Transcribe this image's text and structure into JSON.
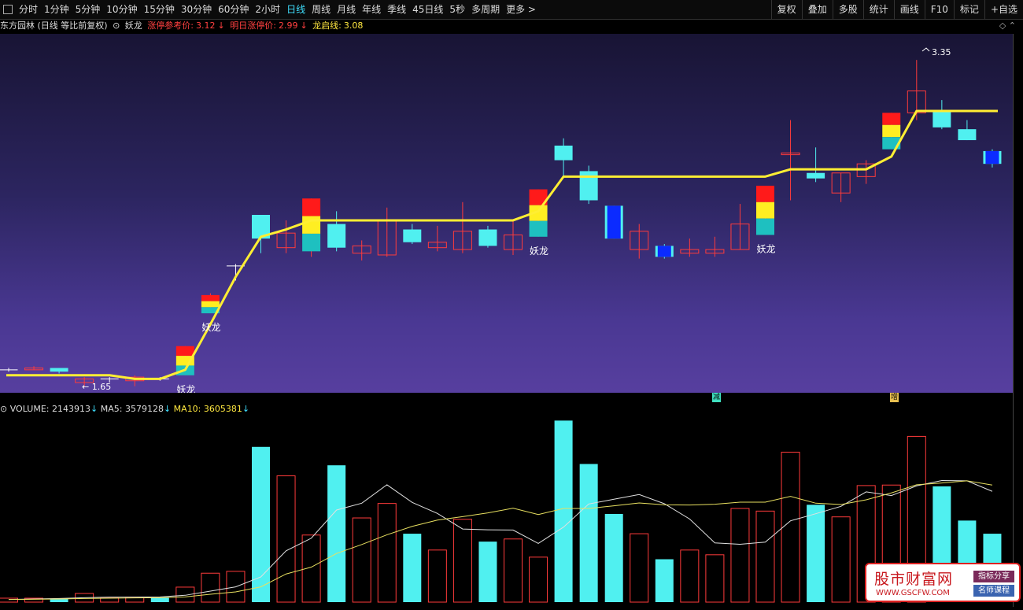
{
  "toolbar": {
    "periods": [
      "分时",
      "1分钟",
      "5分钟",
      "10分钟",
      "15分钟",
      "30分钟",
      "60分钟",
      "2小时",
      "日线",
      "周线",
      "月线",
      "年线",
      "季线",
      "45日线",
      "5秒",
      "多周期",
      "更多 >"
    ],
    "active": "日线",
    "tools": [
      "复权",
      "叠加",
      "多股",
      "统计",
      "画线",
      "F10",
      "标记",
      "+自选"
    ]
  },
  "info": {
    "stock": "东方园林 (日线 等比前复权)",
    "indicator": "妖龙",
    "limit_ref_label": "涨停参考价:",
    "limit_ref_value": "3.12",
    "tomorrow_label": "明日涨停价:",
    "tomorrow_value": "2.99",
    "dragon_label": "龙启线:",
    "dragon_value": "3.08",
    "down_arrow": "↓",
    "right_icons": "◇  ⌃"
  },
  "volume_info": {
    "volume_label": "VOLUME:",
    "volume_value": "2143913",
    "ma5_label": "MA5:",
    "ma5_value": "3579128",
    "ma10_label": "MA10:",
    "ma10_value": "3605381"
  },
  "markers": {
    "mark1": "减",
    "mark2": "增"
  },
  "watermark": {
    "title": "股市财富网",
    "url": "WWW.GSCFW.COM",
    "tag1": "指标分享",
    "tag2": "名师课程"
  },
  "colors": {
    "up": "#ff3b3b",
    "down": "#50f0f0",
    "blue_candle": "#0b2bff",
    "dragon_line": "#ffee33",
    "ma5": "#e0e0e0",
    "ma10": "#e8e060"
  },
  "chart_data": {
    "type": "candlestick",
    "price_range": [
      1.55,
      3.45
    ],
    "annotations": {
      "high_label": "3.35",
      "low_label": "1.65",
      "signal_label": "妖龙"
    },
    "candles": [
      {
        "o": 1.65,
        "c": 1.65,
        "h": 1.66,
        "l": 1.64,
        "dir": "flat"
      },
      {
        "o": 1.65,
        "c": 1.66,
        "h": 1.67,
        "l": 1.65,
        "dir": "up"
      },
      {
        "o": 1.66,
        "c": 1.64,
        "h": 1.66,
        "l": 1.63,
        "dir": "down"
      },
      {
        "o": 1.6,
        "c": 1.58,
        "h": 1.61,
        "l": 1.56,
        "dir": "up"
      },
      {
        "o": 1.6,
        "c": 1.6,
        "h": 1.61,
        "l": 1.58,
        "dir": "flat"
      },
      {
        "o": 1.59,
        "c": 1.61,
        "h": 1.62,
        "l": 1.56,
        "dir": "up"
      },
      {
        "o": 1.6,
        "c": 1.6,
        "h": 1.61,
        "l": 1.59,
        "dir": "flat"
      },
      {
        "o": 1.62,
        "c": 1.78,
        "h": 1.78,
        "l": 1.62,
        "dir": "up",
        "signal": "stack"
      },
      {
        "o": 1.96,
        "c": 2.06,
        "h": 2.07,
        "l": 1.96,
        "dir": "up",
        "signal": "stack"
      },
      {
        "o": 2.22,
        "c": 2.22,
        "h": 2.23,
        "l": 2.14,
        "dir": "flat"
      },
      {
        "o": 2.5,
        "c": 2.37,
        "h": 2.5,
        "l": 2.29,
        "dir": "down"
      },
      {
        "o": 2.32,
        "c": 2.4,
        "h": 2.47,
        "l": 2.29,
        "dir": "up"
      },
      {
        "o": 2.3,
        "c": 2.59,
        "h": 2.59,
        "l": 2.27,
        "dir": "up",
        "signal": "stack"
      },
      {
        "o": 2.45,
        "c": 2.32,
        "h": 2.52,
        "l": 2.3,
        "dir": "down"
      },
      {
        "o": 2.29,
        "c": 2.33,
        "h": 2.36,
        "l": 2.25,
        "dir": "up"
      },
      {
        "o": 2.28,
        "c": 2.47,
        "h": 2.54,
        "l": 2.27,
        "dir": "up"
      },
      {
        "o": 2.42,
        "c": 2.35,
        "h": 2.45,
        "l": 2.34,
        "dir": "down"
      },
      {
        "o": 2.32,
        "c": 2.35,
        "h": 2.44,
        "l": 2.3,
        "dir": "up"
      },
      {
        "o": 2.31,
        "c": 2.41,
        "h": 2.57,
        "l": 2.29,
        "dir": "up"
      },
      {
        "o": 2.42,
        "c": 2.33,
        "h": 2.44,
        "l": 2.32,
        "dir": "down"
      },
      {
        "o": 2.31,
        "c": 2.39,
        "h": 2.47,
        "l": 2.28,
        "dir": "up"
      },
      {
        "o": 2.38,
        "c": 2.64,
        "h": 2.64,
        "l": 2.38,
        "dir": "up",
        "signal": "stack"
      },
      {
        "o": 2.88,
        "c": 2.8,
        "h": 2.92,
        "l": 2.71,
        "dir": "down"
      },
      {
        "o": 2.74,
        "c": 2.58,
        "h": 2.77,
        "l": 2.56,
        "dir": "down"
      },
      {
        "o": 2.55,
        "c": 2.37,
        "h": 2.55,
        "l": 2.37,
        "dir": "down",
        "color": "blue"
      },
      {
        "o": 2.31,
        "c": 2.41,
        "h": 2.45,
        "l": 2.26,
        "dir": "up"
      },
      {
        "o": 2.33,
        "c": 2.27,
        "h": 2.34,
        "l": 2.26,
        "dir": "down",
        "color": "blue"
      },
      {
        "o": 2.31,
        "c": 2.29,
        "h": 2.37,
        "l": 2.27,
        "dir": "up"
      },
      {
        "o": 2.29,
        "c": 2.31,
        "h": 2.38,
        "l": 2.27,
        "dir": "up"
      },
      {
        "o": 2.31,
        "c": 2.45,
        "h": 2.56,
        "l": 2.31,
        "dir": "up"
      },
      {
        "o": 2.39,
        "c": 2.66,
        "h": 2.66,
        "l": 2.39,
        "dir": "up",
        "signal": "stack"
      },
      {
        "o": 2.83,
        "c": 2.84,
        "h": 3.02,
        "l": 2.58,
        "dir": "up"
      },
      {
        "o": 2.73,
        "c": 2.7,
        "h": 2.87,
        "l": 2.68,
        "dir": "down"
      },
      {
        "o": 2.73,
        "c": 2.62,
        "h": 2.73,
        "l": 2.57,
        "dir": "up"
      },
      {
        "o": 2.78,
        "c": 2.71,
        "h": 2.8,
        "l": 2.67,
        "dir": "up"
      },
      {
        "o": 3.06,
        "c": 2.86,
        "h": 3.06,
        "l": 2.86,
        "dir": "up",
        "signal": "stack"
      },
      {
        "o": 3.06,
        "c": 3.18,
        "h": 3.35,
        "l": 3.02,
        "dir": "up"
      },
      {
        "o": 3.07,
        "c": 2.98,
        "h": 3.13,
        "l": 2.97,
        "dir": "down"
      },
      {
        "o": 2.97,
        "c": 2.91,
        "h": 3.02,
        "l": 2.91,
        "dir": "down"
      },
      {
        "o": 2.85,
        "c": 2.78,
        "h": 2.86,
        "l": 2.76,
        "dir": "down",
        "color": "blue"
      }
    ],
    "dragon_line": [
      1.62,
      1.62,
      1.62,
      1.62,
      1.62,
      1.6,
      1.6,
      1.65,
      1.9,
      2.16,
      2.38,
      2.42,
      2.47,
      2.47,
      2.47,
      2.47,
      2.47,
      2.47,
      2.47,
      2.47,
      2.47,
      2.52,
      2.71,
      2.71,
      2.71,
      2.71,
      2.71,
      2.71,
      2.71,
      2.71,
      2.71,
      2.75,
      2.75,
      2.75,
      2.75,
      2.82,
      3.07,
      3.07,
      3.07,
      3.07
    ],
    "volume_max": 7000000,
    "volume": [
      {
        "v": 150000,
        "dir": "up"
      },
      {
        "v": 150000,
        "dir": "up"
      },
      {
        "v": 130000,
        "dir": "down"
      },
      {
        "v": 330000,
        "dir": "up"
      },
      {
        "v": 160000,
        "dir": "up"
      },
      {
        "v": 190000,
        "dir": "up"
      },
      {
        "v": 180000,
        "dir": "down"
      },
      {
        "v": 570000,
        "dir": "up"
      },
      {
        "v": 1100000,
        "dir": "up"
      },
      {
        "v": 1170000,
        "dir": "up"
      },
      {
        "v": 5900000,
        "dir": "down"
      },
      {
        "v": 4800000,
        "dir": "up"
      },
      {
        "v": 2550000,
        "dir": "up"
      },
      {
        "v": 5200000,
        "dir": "down"
      },
      {
        "v": 3200000,
        "dir": "up"
      },
      {
        "v": 3750000,
        "dir": "up"
      },
      {
        "v": 2600000,
        "dir": "down"
      },
      {
        "v": 1980000,
        "dir": "up"
      },
      {
        "v": 3150000,
        "dir": "up"
      },
      {
        "v": 2300000,
        "dir": "down"
      },
      {
        "v": 2400000,
        "dir": "up"
      },
      {
        "v": 1710000,
        "dir": "up"
      },
      {
        "v": 6900000,
        "dir": "down"
      },
      {
        "v": 5250000,
        "dir": "down"
      },
      {
        "v": 3350000,
        "dir": "down"
      },
      {
        "v": 2600000,
        "dir": "up"
      },
      {
        "v": 1630000,
        "dir": "down"
      },
      {
        "v": 1980000,
        "dir": "up"
      },
      {
        "v": 1800000,
        "dir": "up"
      },
      {
        "v": 3560000,
        "dir": "up"
      },
      {
        "v": 3460000,
        "dir": "up"
      },
      {
        "v": 5700000,
        "dir": "up"
      },
      {
        "v": 3700000,
        "dir": "down"
      },
      {
        "v": 3240000,
        "dir": "up"
      },
      {
        "v": 4430000,
        "dir": "up"
      },
      {
        "v": 4450000,
        "dir": "up"
      },
      {
        "v": 6300000,
        "dir": "up"
      },
      {
        "v": 4400000,
        "dir": "down"
      },
      {
        "v": 3100000,
        "dir": "down"
      },
      {
        "v": 2600000,
        "dir": "down"
      }
    ],
    "ma5": [
      100000,
      120000,
      140000,
      170000,
      190000,
      190000,
      200000,
      260000,
      420000,
      580000,
      960000,
      1950000,
      2430000,
      3500000,
      3760000,
      4460000,
      3790000,
      3370000,
      2780000,
      2750000,
      2740000,
      2230000,
      2850000,
      3730000,
      3910000,
      4090000,
      3740000,
      3160000,
      2250000,
      2200000,
      2280000,
      3090000,
      3360000,
      3640000,
      4190000,
      4050000,
      4420000,
      4620000,
      4610000,
      4210000
    ],
    "ma10": [
      100000,
      110000,
      120000,
      140000,
      150000,
      160000,
      170000,
      200000,
      300000,
      390000,
      580000,
      1070000,
      1330000,
      1850000,
      2190000,
      2560000,
      2880000,
      3120000,
      3250000,
      3390000,
      3570000,
      3330000,
      3560000,
      3560000,
      3660000,
      3770000,
      3700000,
      3690000,
      3720000,
      3800000,
      3800000,
      4020000,
      3760000,
      3710000,
      3890000,
      4150000,
      4460000,
      4530000,
      4610000,
      4450000
    ]
  }
}
